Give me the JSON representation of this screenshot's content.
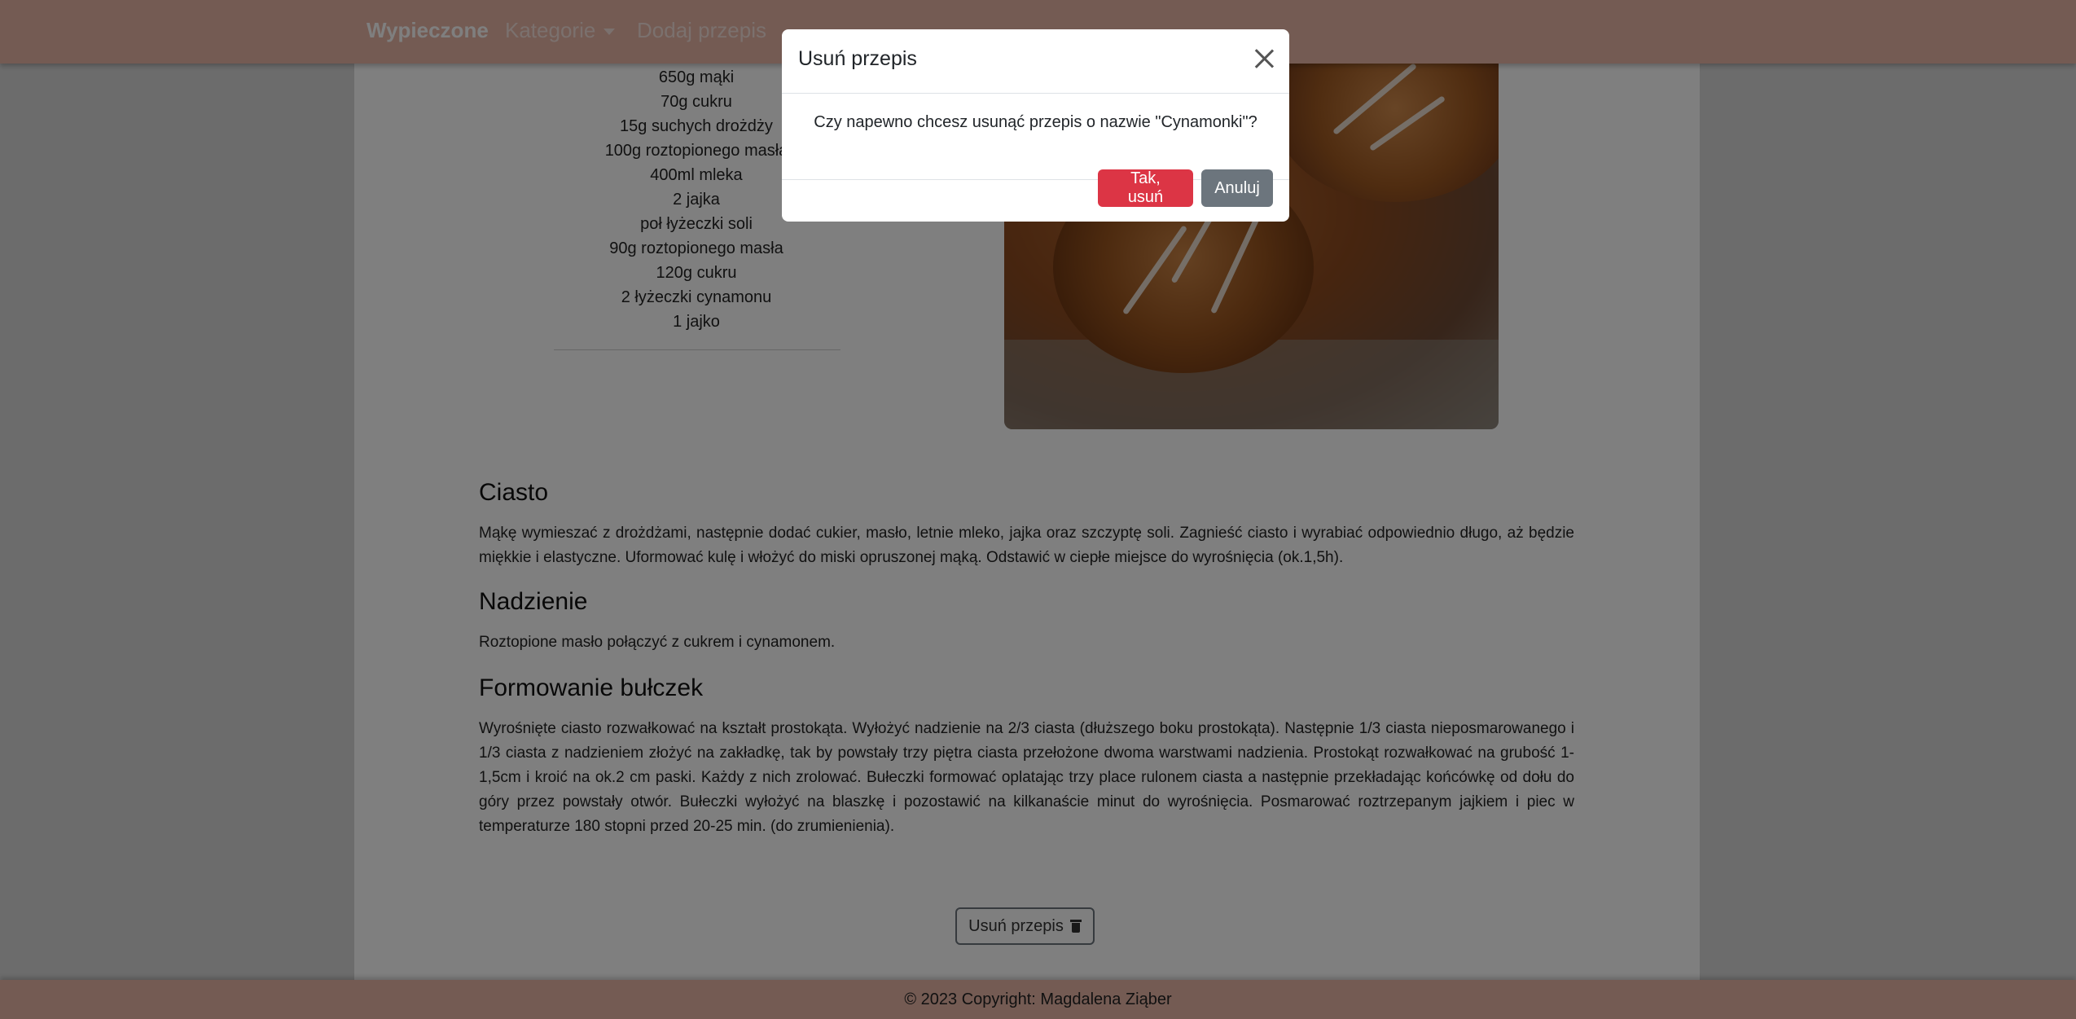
{
  "navbar": {
    "brand": "Wypieczone",
    "categories_label": "Kategorie",
    "add_recipe_label": "Dodaj przepis"
  },
  "ingredients": [
    "650g mąki",
    "70g cukru",
    "15g suchych drożdży",
    "100g roztopionego masła",
    "400ml mleka",
    "2 jajka",
    "poł łyżeczki soli",
    "90g roztopionego masła",
    "120g cukru",
    "2 łyżeczki cynamonu",
    "1 jajko"
  ],
  "sections": [
    {
      "title": "Ciasto",
      "text": "Mąkę wymieszać z drożdżami, następnie dodać cukier, masło, letnie mleko, jajka oraz szczyptę soli. Zagnieść ciasto i wyrabiać odpowiednio długo, aż będzie miękkie i elastyczne. Uformować kulę i włożyć do miski opruszonej mąką. Odstawić w ciepłe miejsce do wyrośnięcia (ok.1,5h)."
    },
    {
      "title": "Nadzienie",
      "text": "Roztopione masło połączyć z cukrem i cynamonem."
    },
    {
      "title": "Formowanie bułczek",
      "text": "Wyrośnięte ciasto rozwałkować na kształt prostokąta. Wyłożyć nadzienie na 2/3 ciasta (dłuższego boku prostokąta). Następnie 1/3 ciasta nieposmarowanego i 1/3 ciasta z nadzieniem złożyć na zakładkę, tak by powstały trzy piętra ciasta przełożone dwoma warstwami nadzienia. Prostokąt rozwałkować na grubość 1-1,5cm i kroić na ok.2 cm paski. Każdy z nich zrolować. Bułeczki formować oplatając trzy place rulonem ciasta a następnie przekładając końcówkę od dołu do góry przez powstały otwór. Bułeczki wyłożyć na blaszkę i pozostawić na kilkanaście minut do wyrośnięcia. Posmarować roztrzepanym jajkiem i piec w temperaturze 180 stopni przed 20-25 min. (do zrumienienia)."
    }
  ],
  "delete_button_label": "Usuń przepis",
  "footer_text": "© 2023 Copyright: Magdalena Ziąber",
  "modal": {
    "title": "Usuń przepis",
    "message": "Czy napewno chcesz usunąć przepis o nazwie \"Cynamonki\"?",
    "confirm_label": "Tak, usuń",
    "cancel_label": "Anuluj"
  },
  "colors": {
    "navbar": "#e8b6a7",
    "danger": "#dc3545",
    "secondary": "#6c757d"
  }
}
